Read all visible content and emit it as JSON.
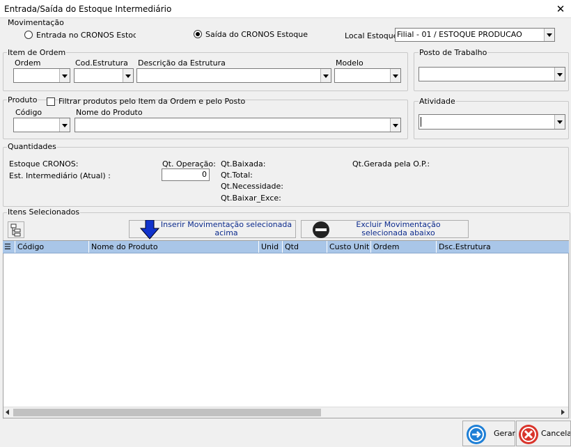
{
  "window": {
    "title": "Entrada/Saída do Estoque Intermediário",
    "close": "✕"
  },
  "movimentacao": {
    "label": "Movimentação",
    "radio_entrada": "Entrada no CRONOS Estoque",
    "radio_saida": "Saída do CRONOS Estoque",
    "selected": "saida",
    "local_label": "Local Estoque:",
    "local_value": "Filial - 01  /  ESTOQUE PRODUCAO"
  },
  "item_ordem": {
    "label": "Item de Ordem",
    "ordem_label": "Ordem",
    "cod_estrutura_label": "Cod.Estrutura",
    "descricao_label": "Descrição da Estrutura",
    "modelo_label": "Modelo"
  },
  "posto": {
    "label": "Posto de Trabalho"
  },
  "produto": {
    "label": "Produto",
    "filter_label": "Filtrar produtos pelo Item da Ordem e pelo Posto",
    "codigo_label": "Código",
    "nome_label": "Nome do Produto"
  },
  "atividade": {
    "label": "Atividade"
  },
  "quantidades": {
    "label": "Quantidades",
    "estoque_cronos": "Estoque CRONOS:",
    "est_intermediario": "Est. Intermediário (Atual) :",
    "qt_operacao_label": "Qt. Operação:",
    "qt_operacao_value": "0",
    "qt_baixada": "Qt.Baixada:",
    "qt_total": "Qt.Total:",
    "qt_necessidade": "Qt.Necessidade:",
    "qt_baixar_exce": "Qt.Baixar_Exce:",
    "qt_gerada": "Qt.Gerada pela O.P.:"
  },
  "itens": {
    "label": "Itens Selecionados",
    "insert_button": "Inserir Movimentação selecionada acima",
    "delete_button": "Excluir Movimentação selecionada abaixo",
    "columns": [
      "Código",
      "Nome do Produto",
      "Unid",
      "Qtd",
      "Custo Unit",
      "Ordem",
      "Dsc.Estrutura"
    ]
  },
  "footer": {
    "gerar": "Gerar",
    "cancelar": "Cancelar"
  },
  "colors": {
    "grid_header": "#a9c6e8",
    "gerar_icon": "#1e7fd6",
    "cancelar_icon": "#d9342b",
    "insert_arrow": "#1133cc"
  }
}
